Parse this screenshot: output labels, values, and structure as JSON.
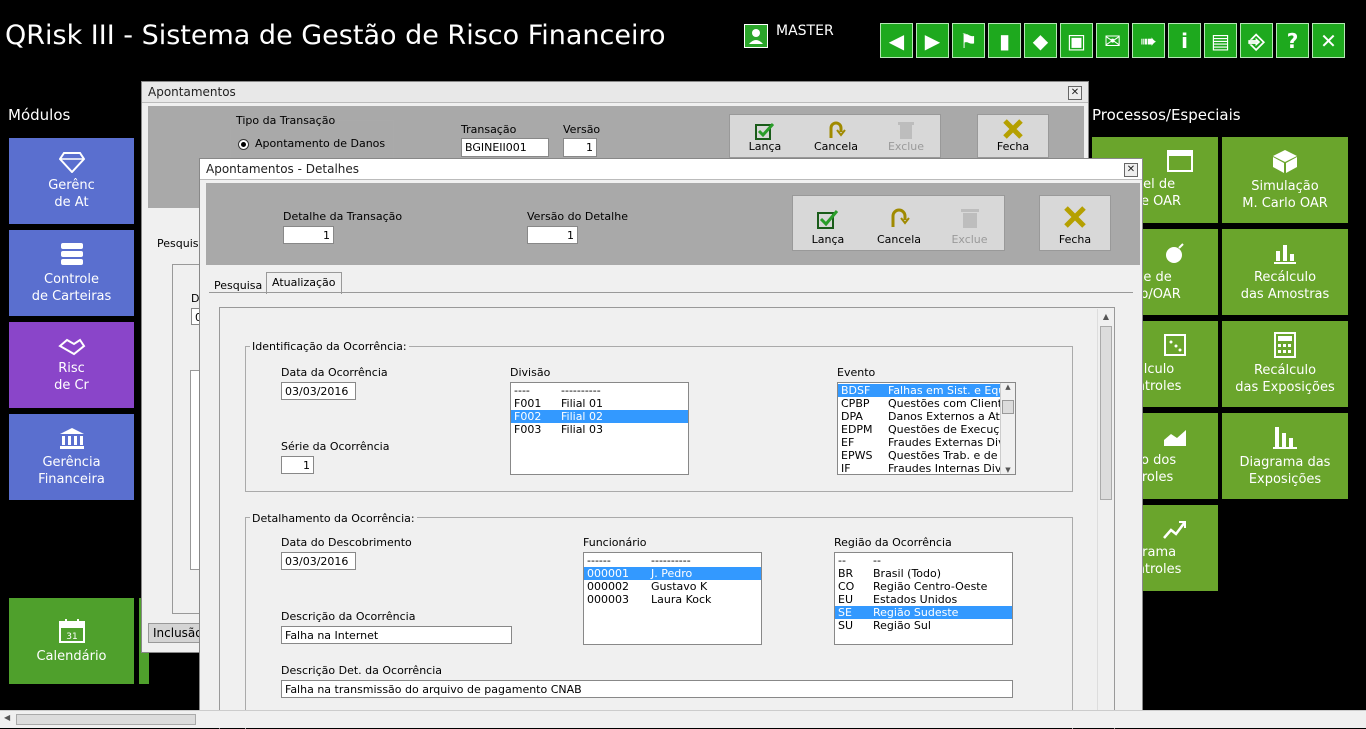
{
  "header": {
    "app_title": "QRisk III - Sistema de Gestão de Risco Financeiro",
    "user": "MASTER",
    "toolbar": [
      {
        "name": "back-icon",
        "glyph": "◀"
      },
      {
        "name": "forward-icon",
        "glyph": "▶"
      },
      {
        "name": "traffic-light-icon",
        "glyph": "⚑"
      },
      {
        "name": "column-icon",
        "glyph": "▮"
      },
      {
        "name": "paint-bucket-icon",
        "glyph": "◆"
      },
      {
        "name": "monitor-icon",
        "glyph": "▣"
      },
      {
        "name": "mail-check-icon",
        "glyph": "✉"
      },
      {
        "name": "send-icon",
        "glyph": "➠"
      },
      {
        "name": "info-icon",
        "glyph": "i"
      },
      {
        "name": "document-settings-icon",
        "glyph": "▤"
      },
      {
        "name": "exit-door-icon",
        "glyph": "⎆"
      },
      {
        "name": "help-icon",
        "glyph": "?"
      },
      {
        "name": "close-icon",
        "glyph": "✕"
      }
    ]
  },
  "modules": {
    "label": "Módulos",
    "tiles": [
      {
        "label": "Gerênc\nde At",
        "color": "#5a6fcf",
        "icon": "diamond-icon"
      },
      {
        "label": "Controle\nde Carteiras",
        "color": "#5a6fcf",
        "icon": "database-icon"
      },
      {
        "label": "Risc\nde Cr",
        "color": "#8a45c9",
        "icon": "handshake-icon"
      },
      {
        "label": "Gerência\nFinanceira",
        "color": "#5a6fcf",
        "icon": "bank-icon"
      },
      {
        "label": "Calendário",
        "color": "#4fa02c",
        "icon": "calendar-icon"
      }
    ]
  },
  "processes": {
    "label": "Processos/Especiais",
    "tiles_left": [
      {
        "label": "nel de\no e OAR",
        "icon": "panel-icon"
      },
      {
        "label": "te de\ns p/OAR",
        "icon": "bomb-icon"
      },
      {
        "label": "álculo\nontroles",
        "icon": "grid-dots-icon"
      },
      {
        "label": "co dos\ntroles",
        "icon": "area-chart-icon"
      },
      {
        "label": "grama\nontroles",
        "icon": "trend-icon"
      }
    ],
    "tiles_right": [
      {
        "label": "Simulação\nM. Carlo OAR",
        "icon": "dice-icon"
      },
      {
        "label": "Recálculo\ndas Amostras",
        "icon": "bar-chart-icon"
      },
      {
        "label": "Recálculo\ndas Exposições",
        "icon": "calculator-icon"
      },
      {
        "label": "Diagrama das\nExposições",
        "icon": "bar-diagram-icon"
      }
    ],
    "color": "#6aa52c"
  },
  "win1": {
    "title": "Apontamentos",
    "tipo_label": "Tipo da Transação",
    "radio_label": "Apontamento de Danos",
    "transacao_label": "Transação",
    "transacao_value": "BGINEII001",
    "versao_label": "Versão",
    "versao_value": "1",
    "btn_lanca": "Lança",
    "btn_cancela": "Cancela",
    "btn_exclue": "Exclue",
    "btn_fecha": "Fecha",
    "tab_pesquisa": "Pesquisa",
    "status_inclusao": "Inclusão",
    "partial_label": "D",
    "partial_value": "03"
  },
  "win2": {
    "title": "Apontamentos - Detalhes",
    "detalhe_label": "Detalhe da Transação",
    "detalhe_value": "1",
    "versao_det_label": "Versão do Detalhe",
    "versao_det_value": "1",
    "btn_lanca": "Lança",
    "btn_cancela": "Cancela",
    "btn_exclue": "Exclue",
    "btn_fecha": "Fecha",
    "tabs": [
      "Pesquisa",
      "Atualização"
    ],
    "ident": {
      "group_label": "Identificação da Ocorrência:",
      "data_label": "Data da Ocorrência",
      "data_value": "03/03/2016",
      "serie_label": "Série da Ocorrência",
      "serie_value": "1",
      "divisao_label": "Divisão",
      "divisao_rows": [
        {
          "code": "----",
          "desc": "----------",
          "sel": false
        },
        {
          "code": "F001",
          "desc": "Filial 01",
          "sel": false
        },
        {
          "code": "F002",
          "desc": "Filial 02",
          "sel": true
        },
        {
          "code": "F003",
          "desc": "Filial 03",
          "sel": false
        }
      ],
      "evento_label": "Evento",
      "evento_rows": [
        {
          "code": "BDSF",
          "desc": "Falhas em Sist. e Equi",
          "sel": true
        },
        {
          "code": "CPBP",
          "desc": "Questões com Cliente",
          "sel": false
        },
        {
          "code": "DPA",
          "desc": "Danos Externos a Ativ",
          "sel": false
        },
        {
          "code": "EDPM",
          "desc": "Questões de Execuçã",
          "sel": false
        },
        {
          "code": "EF",
          "desc": "Fraudes Externas Dive",
          "sel": false
        },
        {
          "code": "EPWS",
          "desc": "Questões Trab. e de S",
          "sel": false
        },
        {
          "code": "IF",
          "desc": "Fraudes Internas Dive",
          "sel": false
        }
      ]
    },
    "detal": {
      "group_label": "Detalhamento da Ocorrência:",
      "desc_data_label": "Data do Descobrimento",
      "desc_data_value": "03/03/2016",
      "descricao_label": "Descrição da Ocorrência",
      "descricao_value": "Falha na Internet",
      "desc_det_label": "Descrição Det. da Ocorrência",
      "desc_det_value": "Falha na transmissão do arquivo de pagamento CNAB",
      "func_label": "Funcionário",
      "func_rows": [
        {
          "code": "------",
          "desc": "----------",
          "sel": false
        },
        {
          "code": "000001",
          "desc": "J. Pedro",
          "sel": true
        },
        {
          "code": "000002",
          "desc": "Gustavo K",
          "sel": false
        },
        {
          "code": "000003",
          "desc": "Laura Kock",
          "sel": false
        }
      ],
      "regiao_label": "Região da Ocorrência",
      "regiao_rows": [
        {
          "code": "--",
          "desc": "--",
          "sel": false
        },
        {
          "code": "BR",
          "desc": "Brasil (Todo)",
          "sel": false
        },
        {
          "code": "CO",
          "desc": "Região Centro-Oeste",
          "sel": false
        },
        {
          "code": "EU",
          "desc": "Estados Unidos",
          "sel": false
        },
        {
          "code": "SE",
          "desc": "Região Sudeste",
          "sel": true
        },
        {
          "code": "SU",
          "desc": "Região Sul",
          "sel": false
        }
      ]
    }
  }
}
